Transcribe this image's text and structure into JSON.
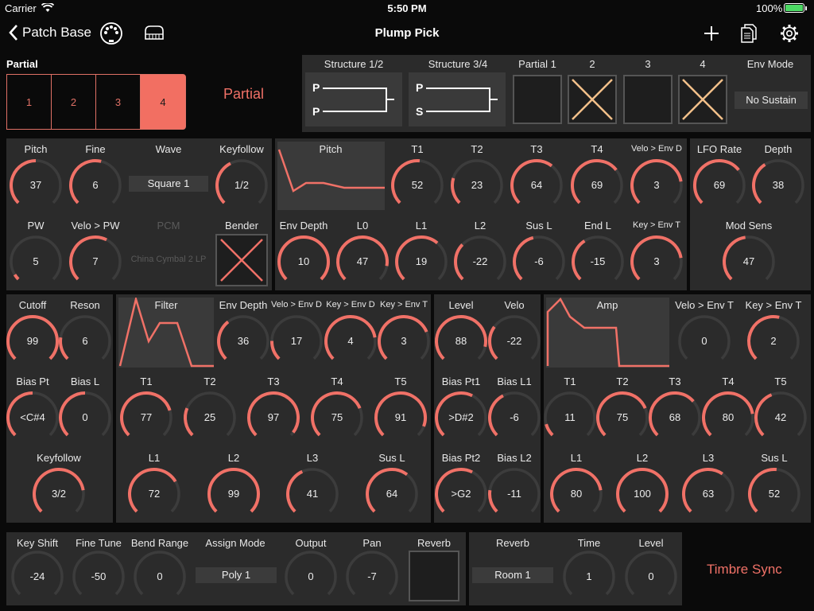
{
  "status": {
    "carrier": "Carrier",
    "time": "5:50 PM",
    "battery": "100%"
  },
  "nav": {
    "back": "Patch Base",
    "title": "Plump Pick"
  },
  "partial": {
    "title": "Partial",
    "tabs": [
      "1",
      "2",
      "3",
      "4"
    ],
    "selected": "4",
    "side_label": "Partial"
  },
  "structure": {
    "s12_label": "Structure 1/2",
    "s34_label": "Structure 3/4",
    "s12": [
      "P",
      "P"
    ],
    "s34": [
      "P",
      "S"
    ],
    "partials": [
      "Partial 1",
      "2",
      "3",
      "4"
    ],
    "env_mode_label": "Env Mode",
    "env_mode": "No Sustain"
  },
  "pitch_sec": {
    "pitch": {
      "label": "Pitch",
      "value": "37",
      "pct": 0.5
    },
    "fine": {
      "label": "Fine",
      "value": "6",
      "pct": 0.55
    },
    "wave": {
      "label": "Wave",
      "value": "Square 1"
    },
    "keyfollow": {
      "label": "Keyfollow",
      "value": "1/2",
      "pct": 0.4
    },
    "pw": {
      "label": "PW",
      "value": "5",
      "pct": 0.05
    },
    "velo_pw": {
      "label": "Velo > PW",
      "value": "7",
      "pct": 0.6
    },
    "pcm": {
      "label": "PCM",
      "value": "China Cymbal 2 LP"
    },
    "bender": {
      "label": "Bender"
    }
  },
  "pitch_env": {
    "title": "Pitch",
    "t1": {
      "label": "T1",
      "value": "52",
      "pct": 0.52
    },
    "t2": {
      "label": "T2",
      "value": "23",
      "pct": 0.23
    },
    "t3": {
      "label": "T3",
      "value": "64",
      "pct": 0.64
    },
    "t4": {
      "label": "T4",
      "value": "69",
      "pct": 0.69
    },
    "velo_env_d": {
      "label": "Velo > Env D",
      "value": "3",
      "pct": 0.8
    },
    "env_depth": {
      "label": "Env Depth",
      "value": "10",
      "pct": 1.0
    },
    "l0": {
      "label": "L0",
      "value": "47",
      "pct": 0.87
    },
    "l1": {
      "label": "L1",
      "value": "19",
      "pct": 0.65
    },
    "l2": {
      "label": "L2",
      "value": "-22",
      "pct": 0.33
    },
    "sus_l": {
      "label": "Sus L",
      "value": "-6",
      "pct": 0.45
    },
    "end_l": {
      "label": "End L",
      "value": "-15",
      "pct": 0.38
    },
    "key_env_t": {
      "label": "Key > Env T",
      "value": "3",
      "pct": 0.8
    }
  },
  "lfo": {
    "rate": {
      "label": "LFO Rate",
      "value": "69",
      "pct": 0.69
    },
    "depth": {
      "label": "Depth",
      "value": "38",
      "pct": 0.38
    },
    "mod_sens": {
      "label": "Mod Sens",
      "value": "47",
      "pct": 0.47
    }
  },
  "filter": {
    "cutoff": {
      "label": "Cutoff",
      "value": "99",
      "pct": 1.0
    },
    "reson": {
      "label": "Reson",
      "value": "6",
      "pct": 0.2
    },
    "bias_pt": {
      "label": "Bias Pt",
      "value": "<C#4",
      "pct": 0.5
    },
    "bias_l": {
      "label": "Bias L",
      "value": "0",
      "pct": 0.5
    },
    "keyfollow": {
      "label": "Keyfollow",
      "value": "3/2",
      "pct": 0.8
    },
    "title": "Filter",
    "env_depth": {
      "label": "Env Depth",
      "value": "36",
      "pct": 0.36
    },
    "velo_env_d": {
      "label": "Velo > Env D",
      "value": "17",
      "pct": 0.17
    },
    "key_env_d": {
      "label": "Key > Env D",
      "value": "4",
      "pct": 0.8
    },
    "key_env_t": {
      "label": "Key > Env T",
      "value": "3",
      "pct": 0.75
    },
    "t1": {
      "label": "T1",
      "value": "77",
      "pct": 0.77
    },
    "t2": {
      "label": "T2",
      "value": "25",
      "pct": 0.25
    },
    "t3": {
      "label": "T3",
      "value": "97",
      "pct": 0.97
    },
    "t4": {
      "label": "T4",
      "value": "75",
      "pct": 0.75
    },
    "t5": {
      "label": "T5",
      "value": "91",
      "pct": 0.91
    },
    "l1": {
      "label": "L1",
      "value": "72",
      "pct": 0.72
    },
    "l2": {
      "label": "L2",
      "value": "99",
      "pct": 1.0
    },
    "l3": {
      "label": "L3",
      "value": "41",
      "pct": 0.41
    },
    "sus_l": {
      "label": "Sus L",
      "value": "64",
      "pct": 0.64
    }
  },
  "amp": {
    "level": {
      "label": "Level",
      "value": "88",
      "pct": 0.88
    },
    "velo": {
      "label": "Velo",
      "value": "-22",
      "pct": 0.3
    },
    "bias_pt1": {
      "label": "Bias Pt1",
      "value": ">D#2",
      "pct": 0.6
    },
    "bias_l1": {
      "label": "Bias L1",
      "value": "-6",
      "pct": 0.4
    },
    "bias_pt2": {
      "label": "Bias Pt2",
      "value": ">G2",
      "pct": 0.6
    },
    "bias_l2": {
      "label": "Bias L2",
      "value": "-11",
      "pct": 0.2
    },
    "title": "Amp",
    "velo_env_t": {
      "label": "Velo > Env T",
      "value": "0",
      "pct": 0.0
    },
    "key_env_t": {
      "label": "Key > Env T",
      "value": "2",
      "pct": 0.55
    },
    "t1": {
      "label": "T1",
      "value": "11",
      "pct": 0.11
    },
    "t2": {
      "label": "T2",
      "value": "75",
      "pct": 0.75
    },
    "t3": {
      "label": "T3",
      "value": "68",
      "pct": 0.68
    },
    "t4": {
      "label": "T4",
      "value": "80",
      "pct": 0.8
    },
    "t5": {
      "label": "T5",
      "value": "42",
      "pct": 0.42
    },
    "l1": {
      "label": "L1",
      "value": "80",
      "pct": 0.8
    },
    "l2": {
      "label": "L2",
      "value": "100",
      "pct": 1.0
    },
    "l3": {
      "label": "L3",
      "value": "63",
      "pct": 0.63
    },
    "sus_l": {
      "label": "Sus L",
      "value": "52",
      "pct": 0.52
    }
  },
  "common": {
    "key_shift": {
      "label": "Key Shift",
      "value": "-24",
      "pct": 0.0
    },
    "fine_tune": {
      "label": "Fine Tune",
      "value": "-50",
      "pct": 0.0
    },
    "bend_range": {
      "label": "Bend Range",
      "value": "0",
      "pct": 0.0
    },
    "assign_mode": {
      "label": "Assign Mode",
      "value": "Poly 1"
    },
    "output": {
      "label": "Output",
      "value": "0",
      "pct": 0.0
    },
    "pan": {
      "label": "Pan",
      "value": "-7",
      "pct": 0.0
    },
    "reverb_sw": {
      "label": "Reverb"
    },
    "reverb_type": {
      "label": "Reverb",
      "value": "Room 1"
    },
    "time": {
      "label": "Time",
      "value": "1",
      "pct": 0.0
    },
    "level": {
      "label": "Level",
      "value": "0",
      "pct": 0.0
    }
  },
  "timbre_sync": "Timbre Sync",
  "colors": {
    "accent": "#f07167",
    "track": "#3c3c3c",
    "panel": "#2b2b2b",
    "highlight": "#f26f62",
    "cross": "#f3c08a"
  },
  "icons": {
    "wifi": "wifi-icon",
    "battery": "battery-icon",
    "back": "chevron-left-icon",
    "midi": "midi-connector-icon",
    "piano": "piano-keyboard-icon",
    "add": "plus-icon",
    "docs": "documents-icon",
    "settings": "gear-icon"
  }
}
